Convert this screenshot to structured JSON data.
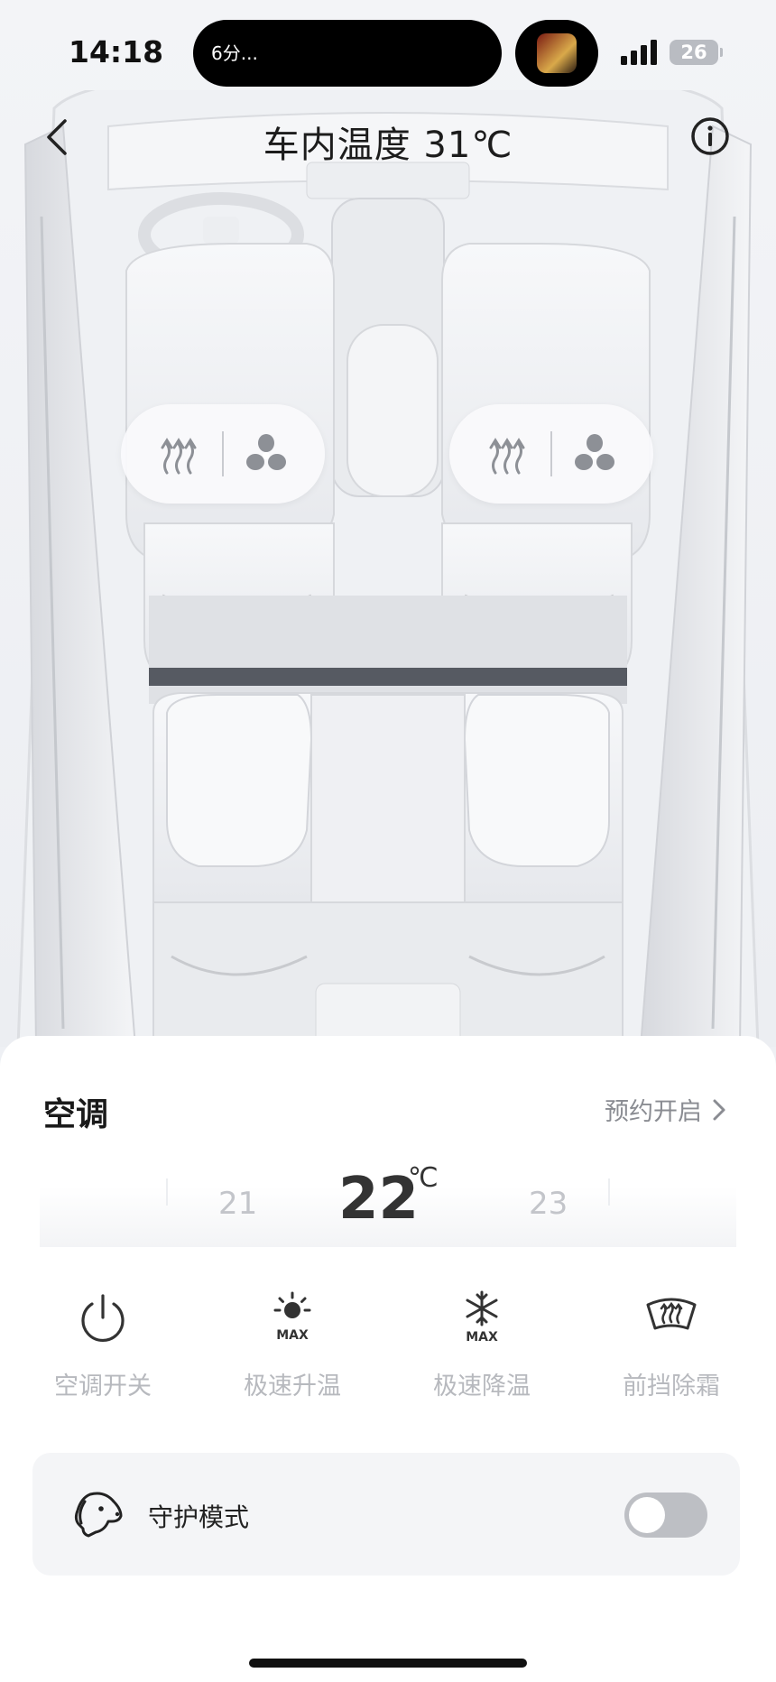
{
  "status_bar": {
    "time": "14:18",
    "island_text": "6分...",
    "battery": "26"
  },
  "nav": {
    "title": "车内温度 31℃",
    "back_icon": "chevron-left-icon",
    "info_icon": "info-circle-icon"
  },
  "seats": {
    "front_left": {
      "heat_icon": "seat-heat-icon",
      "fan_icon": "seat-fan-icon"
    },
    "front_right": {
      "heat_icon": "seat-heat-icon",
      "fan_icon": "seat-fan-icon"
    }
  },
  "ac": {
    "title": "空调",
    "schedule_label": "预约开启",
    "temperature": {
      "prev": "21",
      "current": "22",
      "unit": "℃",
      "next": "23"
    },
    "controls": [
      {
        "label": "空调开关",
        "icon": "power-icon"
      },
      {
        "label": "极速升温",
        "icon": "sun-max-icon",
        "badge": "MAX"
      },
      {
        "label": "极速降温",
        "icon": "snowflake-max-icon",
        "badge": "MAX"
      },
      {
        "label": "前挡除霜",
        "icon": "windshield-defrost-icon"
      }
    ]
  },
  "guard_mode": {
    "label": "守护模式",
    "icon": "dog-icon",
    "enabled": false
  },
  "colors": {
    "sheet_bg": "#ffffff",
    "muted_text": "#b7b9be",
    "toggle_off": "#bdbfc4"
  }
}
